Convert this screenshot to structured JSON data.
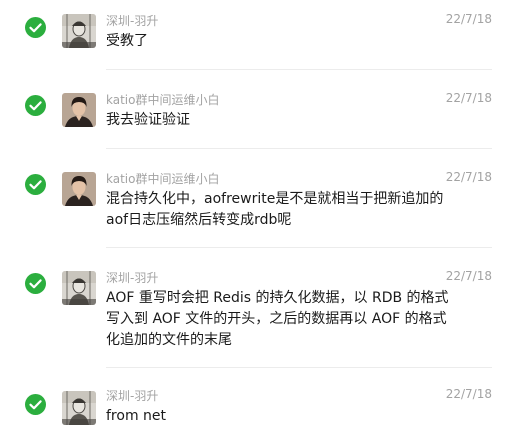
{
  "messages": [
    {
      "sender": "深圳-羽升",
      "time": "22/7/18",
      "avatar": "sketch-avatar-icon",
      "lines": [
        "受教了"
      ]
    },
    {
      "sender": "katio群中间运维小白",
      "time": "22/7/18",
      "avatar": "portrait-avatar-icon",
      "lines": [
        "我去验证验证"
      ]
    },
    {
      "sender": "katio群中间运维小白",
      "time": "22/7/18",
      "avatar": "portrait-avatar-icon",
      "lines": [
        "混合持久化中，aofrewrite是不是就相当于把新追加的",
        "aof日志压缩然后转变成rdb呢"
      ]
    },
    {
      "sender": "深圳-羽升",
      "time": "22/7/18",
      "avatar": "sketch-avatar-icon",
      "lines": [
        "AOF 重写时会把 Redis 的持久化数据，以 RDB 的格式",
        "写入到 AOF 文件的开头，之后的数据再以 AOF 的格式",
        "化追加的文件的末尾"
      ]
    },
    {
      "sender": "深圳-羽升",
      "time": "22/7/18",
      "avatar": "sketch-avatar-icon",
      "lines": [
        "from net"
      ]
    }
  ],
  "colors": {
    "check": "#2bae3e",
    "meta_text": "#a3a3a3",
    "body_text": "#1a1a1a",
    "divider": "#ececec"
  }
}
